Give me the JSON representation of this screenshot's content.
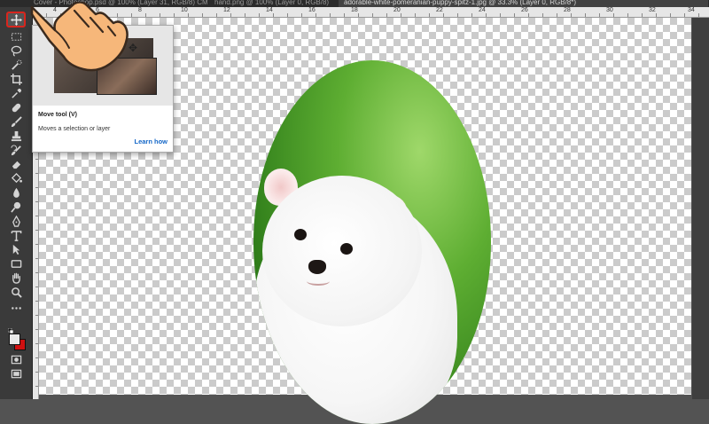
{
  "tabs": [
    {
      "label": "Cover - Photoshop.psd @ 100% (Layer 31, RGB/8) CMYK/8"
    },
    {
      "label": "hand.png @ 100% (Layer 0, RGB/8)"
    },
    {
      "label": "adorable-white-pomeranian-puppy-spitz-1.jpg @ 33.3% (Layer 0, RGB/8*)"
    }
  ],
  "rulers": {
    "top_numbers": [
      "4",
      "6",
      "8",
      "10",
      "12",
      "14",
      "16",
      "18",
      "20",
      "22",
      "24",
      "26",
      "28",
      "30",
      "32",
      "34"
    ]
  },
  "toolbar": {
    "tools": [
      {
        "name": "move-tool",
        "glyph": "✥"
      },
      {
        "name": "marquee-tool",
        "glyph": "⬚"
      },
      {
        "name": "lasso-tool",
        "glyph": "ℓ"
      },
      {
        "name": "quick-select-tool",
        "glyph": "✎"
      },
      {
        "name": "crop-tool",
        "glyph": "⌗"
      },
      {
        "name": "eyedropper-tool",
        "glyph": "✐"
      },
      {
        "name": "healing-brush-tool",
        "glyph": "✚"
      },
      {
        "name": "brush-tool",
        "glyph": "🖌"
      },
      {
        "name": "clone-stamp-tool",
        "glyph": "♜"
      },
      {
        "name": "history-brush-tool",
        "glyph": "↺"
      },
      {
        "name": "eraser-tool",
        "glyph": "◇"
      },
      {
        "name": "paint-bucket-tool",
        "glyph": "◈"
      },
      {
        "name": "blur-tool",
        "glyph": "●"
      },
      {
        "name": "dodge-tool",
        "glyph": "◐"
      },
      {
        "name": "pen-tool",
        "glyph": "✒"
      },
      {
        "name": "type-tool",
        "glyph": "T"
      },
      {
        "name": "path-select-tool",
        "glyph": "➤"
      },
      {
        "name": "rectangle-tool",
        "glyph": "▭"
      },
      {
        "name": "hand-tool",
        "glyph": "✋"
      },
      {
        "name": "zoom-tool",
        "glyph": "⌕"
      },
      {
        "name": "more-tools",
        "glyph": "•••"
      }
    ],
    "foreground_color": "#e9e9e9",
    "background_color": "#d01010"
  },
  "tooltip": {
    "title": "Move tool (V)",
    "description": "Moves a selection or layer",
    "link": "Learn how"
  },
  "colors": {
    "highlight": "#d9251d",
    "link": "#1467c8"
  }
}
